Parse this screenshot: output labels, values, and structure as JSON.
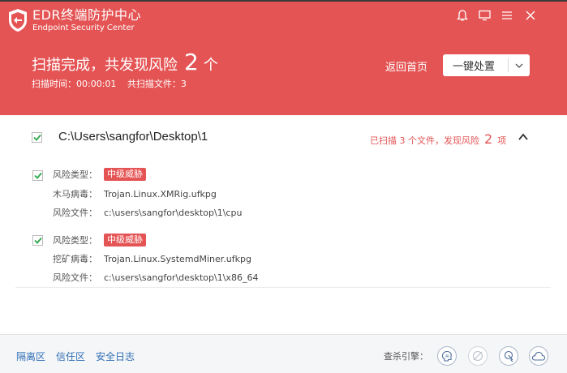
{
  "app": {
    "title": "EDR终端防护中心",
    "subtitle": "Endpoint Security Center",
    "window_icons": [
      "bell-icon",
      "monitor-icon",
      "menu-icon",
      "close-icon"
    ]
  },
  "headline": {
    "text": "扫描完成，共发现风险",
    "count": "2",
    "unit": "个"
  },
  "scan_info": {
    "time": "扫描时间：00:00:01",
    "files": "共扫描文件：3"
  },
  "header_actions": {
    "home": "返回首页",
    "primary_action": "一键处置"
  },
  "group": {
    "path": "C:\\Users\\sangfor\\Desktop\\1",
    "summary_prefix": "已扫描 3 个文件，发现风险",
    "summary_count": "2",
    "summary_suffix": "项",
    "checked": true
  },
  "threats": [
    {
      "checked": true,
      "type_label": "风险类型：",
      "type_value": "中级威胁",
      "name_label": "木马病毒：",
      "name_value": "Trojan.Linux.XMRig.ufkpg",
      "file_label": "风险文件：",
      "file_value": "c:\\users\\sangfor\\desktop\\1\\cpu"
    },
    {
      "checked": true,
      "type_label": "风险类型：",
      "type_value": "中级威胁",
      "name_label": "挖矿病毒：",
      "name_value": "Trojan.Linux.SystemdMiner.ufkpg",
      "file_label": "风险文件：",
      "file_value": "c:\\users\\sangfor\\desktop\\1\\x86_64"
    }
  ],
  "footer": {
    "links": [
      "隔离区",
      "信任区",
      "安全日志"
    ],
    "engine_label": "查杀引擎：",
    "engines": [
      "ai-engine-icon",
      "disabled-engine-icon",
      "behavior-engine-icon",
      "cloud-engine-icon"
    ]
  },
  "colors": {
    "header_bg": "#e55454",
    "accent_green": "#2aa84a",
    "link_blue": "#2f6fb5"
  }
}
